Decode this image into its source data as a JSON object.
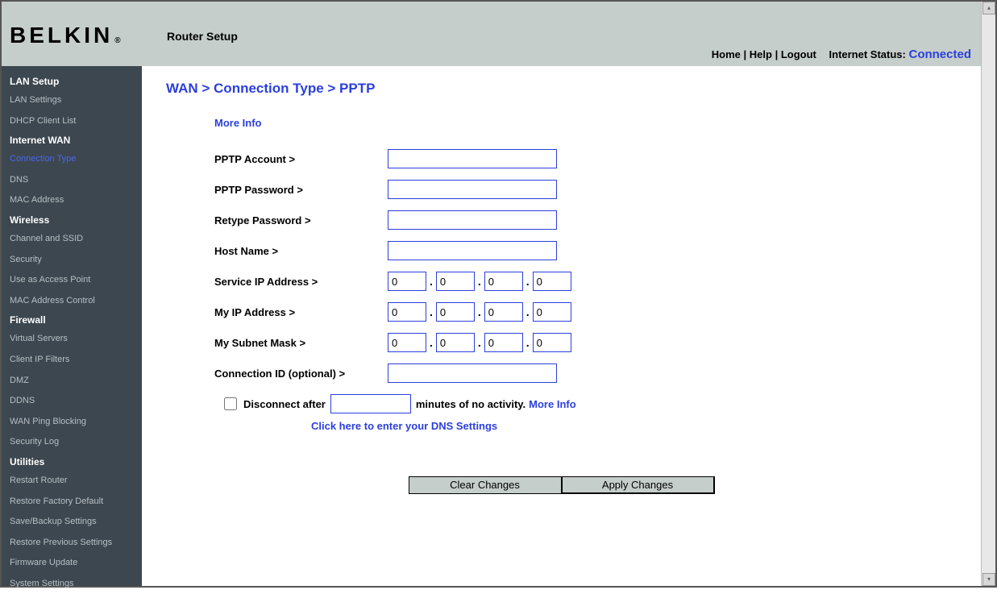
{
  "header": {
    "brand": "BELKIN",
    "title": "Router Setup",
    "links": {
      "home": "Home",
      "help": "Help",
      "logout": "Logout"
    },
    "status_label": "Internet Status:",
    "status_value": "Connected"
  },
  "sidebar": {
    "lan_setup": {
      "head": "LAN Setup",
      "settings": "LAN Settings",
      "dhcp": "DHCP Client List"
    },
    "wan": {
      "head": "Internet WAN",
      "conn": "Connection Type",
      "dns": "DNS",
      "mac": "MAC Address"
    },
    "wireless": {
      "head": "Wireless",
      "channel": "Channel and SSID",
      "security": "Security",
      "ap": "Use as Access Point",
      "maccontrol": "MAC Address Control"
    },
    "firewall": {
      "head": "Firewall",
      "vservers": "Virtual Servers",
      "ipfilters": "Client IP Filters",
      "dmz": "DMZ",
      "ddns": "DDNS",
      "pingblock": "WAN Ping Blocking",
      "seclog": "Security Log"
    },
    "utilities": {
      "head": "Utilities",
      "restart": "Restart Router",
      "factory": "Restore Factory Default",
      "backup": "Save/Backup Settings",
      "restore": "Restore Previous Settings",
      "firmware": "Firmware Update",
      "system": "System Settings"
    }
  },
  "main": {
    "breadcrumb": "WAN >  Connection Type > PPTP",
    "more_info": "More Info",
    "labels": {
      "account": "PPTP Account >",
      "password": "PPTP Password >",
      "retype": "Retype Password >",
      "hostname": "Host Name >",
      "service_ip": "Service IP Address >",
      "my_ip": "My IP Address >",
      "subnet": "My Subnet Mask >",
      "conn_id": "Connection ID (optional) >"
    },
    "values": {
      "account": "",
      "password": "",
      "retype": "",
      "hostname": "",
      "service_ip": [
        "0",
        "0",
        "0",
        "0"
      ],
      "my_ip": [
        "0",
        "0",
        "0",
        "0"
      ],
      "subnet": [
        "0",
        "0",
        "0",
        "0"
      ],
      "conn_id": "",
      "disconnect_minutes": ""
    },
    "disconnect_prefix": "Disconnect after",
    "disconnect_suffix": "minutes of no activity.",
    "disconnect_more_info": "More Info",
    "dns_link": "Click here to enter your DNS Settings",
    "buttons": {
      "clear": "Clear Changes",
      "apply": "Apply Changes"
    }
  }
}
